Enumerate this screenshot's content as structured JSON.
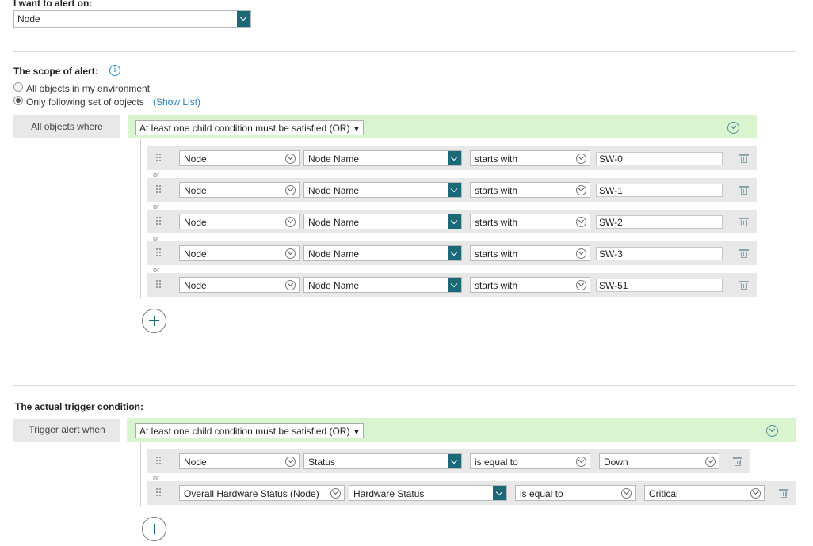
{
  "alert_on": {
    "label": "I want to alert on:",
    "selected": "Node"
  },
  "scope": {
    "title": "The scope of alert:",
    "info_icon": "info-icon",
    "options": [
      {
        "label": "All objects in my environment",
        "checked": false
      },
      {
        "label": "Only following set of objects",
        "checked": true
      }
    ],
    "show_list_link": "(Show List)",
    "side_label": "All objects where",
    "group_mode": "At least one child condition must be satisfied (OR)",
    "or_label": "or",
    "conditions": [
      {
        "object": "Node",
        "field": "Node Name",
        "operator": "starts with",
        "value": "SW-0"
      },
      {
        "object": "Node",
        "field": "Node Name",
        "operator": "starts with",
        "value": "SW-1"
      },
      {
        "object": "Node",
        "field": "Node Name",
        "operator": "starts with",
        "value": "SW-2"
      },
      {
        "object": "Node",
        "field": "Node Name",
        "operator": "starts with",
        "value": "SW-3"
      },
      {
        "object": "Node",
        "field": "Node Name",
        "operator": "starts with",
        "value": "SW-51"
      }
    ]
  },
  "trigger": {
    "title": "The actual trigger condition:",
    "side_label": "Trigger alert when",
    "group_mode": "At least one child condition must be satisfied (OR)",
    "or_label": "or",
    "conditions": [
      {
        "object": "Node",
        "field": "Status",
        "operator": "is equal to",
        "value": "Down"
      },
      {
        "object": "Overall Hardware Status (Node)",
        "field": "Hardware Status",
        "operator": "is equal to",
        "value": "Critical"
      }
    ]
  },
  "icons": {
    "add": "plus-circle-icon",
    "delete": "trash-icon",
    "drag": "drag-handle-icon",
    "collapse": "chevron-down-circle-icon"
  },
  "colors": {
    "accent": "#1b6977",
    "group_bar": "#d9f5d0",
    "row_bg": "#e8e8e8",
    "link": "#1f7fb8"
  }
}
